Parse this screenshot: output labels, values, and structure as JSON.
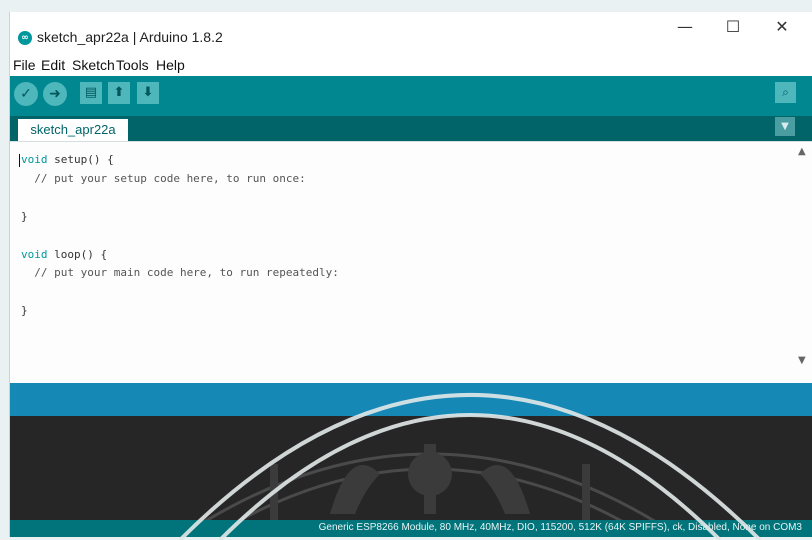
{
  "window": {
    "title": "sketch_apr22a | Arduino 1.8.2",
    "logo_text": "∞",
    "controls": {
      "minimize": "—",
      "maximize": "☐",
      "close": "✕"
    }
  },
  "menu": {
    "file": "File",
    "edit": "Edit",
    "sketch": "Sketch",
    "tools": "Tools",
    "help": "Help"
  },
  "toolbar": {
    "verify_icon": "check-icon",
    "upload_icon": "arrow-right-icon",
    "new_icon": "new-file-icon",
    "open_icon": "arrow-up-icon",
    "save_icon": "arrow-down-icon",
    "serial_monitor_icon": "magnifier-icon"
  },
  "tabs": {
    "active": "sketch_apr22a"
  },
  "editor": {
    "lines": [
      {
        "kw": "void",
        "rest": " setup() {"
      },
      {
        "comment": "  // put your setup code here, to run once:"
      },
      {
        "text": ""
      },
      {
        "text": "}"
      },
      {
        "text": ""
      },
      {
        "kw": "void",
        "rest": " loop() {"
      },
      {
        "comment": "  // put your main code here, to run repeatedly:"
      },
      {
        "text": ""
      },
      {
        "text": "}"
      }
    ]
  },
  "status": {
    "board_info": "Generic ESP8266 Module, 80 MHz, 40MHz, DIO, 115200, 512K (64K SPIFFS), ck, Disabled, None on COM3"
  },
  "colors": {
    "toolbar": "#00878f",
    "tabbar": "#006468",
    "message": "#1588b6",
    "console": "#262626",
    "statusbar": "#00747a",
    "keyword": "#00979c"
  }
}
